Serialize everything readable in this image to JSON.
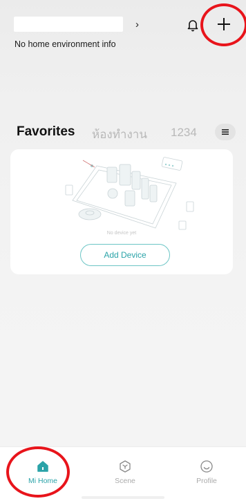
{
  "header": {
    "home_chevron": "›",
    "home_info": "No home environment info",
    "bell_icon": "bell-icon",
    "add_icon": "plus-icon"
  },
  "tabs": [
    {
      "label": "Favorites",
      "active": true
    },
    {
      "label": "ห้องทำงาน",
      "active": false
    },
    {
      "label": "1234",
      "active": false
    }
  ],
  "tab_menu_icon": "menu-icon",
  "card": {
    "empty_text": "No device yet",
    "add_device_label": "Add Device"
  },
  "nav": [
    {
      "label": "Mi Home",
      "icon": "home-icon",
      "active": true
    },
    {
      "label": "Scene",
      "icon": "scene-icon",
      "active": false
    },
    {
      "label": "Profile",
      "icon": "profile-icon",
      "active": false
    }
  ],
  "colors": {
    "accent": "#2aa3a8",
    "annotation": "#e8141b",
    "inactive": "#aaaaaa"
  }
}
